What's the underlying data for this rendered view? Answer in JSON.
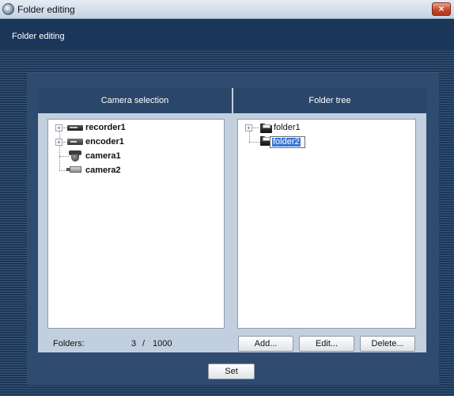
{
  "window": {
    "title": "Folder editing",
    "close_glyph": "×"
  },
  "header": {
    "title": "Folder editing"
  },
  "camera_selection": {
    "header": "Camera selection",
    "items": [
      {
        "label": "recorder1",
        "icon": "recorder-icon"
      },
      {
        "label": "encoder1",
        "icon": "encoder-icon"
      },
      {
        "label": "camera1",
        "icon": "dome-camera-icon"
      },
      {
        "label": "camera2",
        "icon": "box-camera-icon"
      }
    ]
  },
  "folder_tree": {
    "header": "Folder tree",
    "items": [
      {
        "label": "folder1",
        "icon": "folder-icon"
      },
      {
        "label": "folder2",
        "icon": "folder-icon",
        "editing": true
      }
    ]
  },
  "status": {
    "folders_label": "Folders:",
    "count": "3",
    "separator": "/",
    "max": "1000"
  },
  "buttons": {
    "add": "Add...",
    "edit": "Edit...",
    "delete": "Delete...",
    "set": "Set"
  },
  "expander_glyph": "+",
  "colors": {
    "header_bg": "#1a3658",
    "panel_bg": "#2f4b70",
    "selection": "#3875d7"
  }
}
